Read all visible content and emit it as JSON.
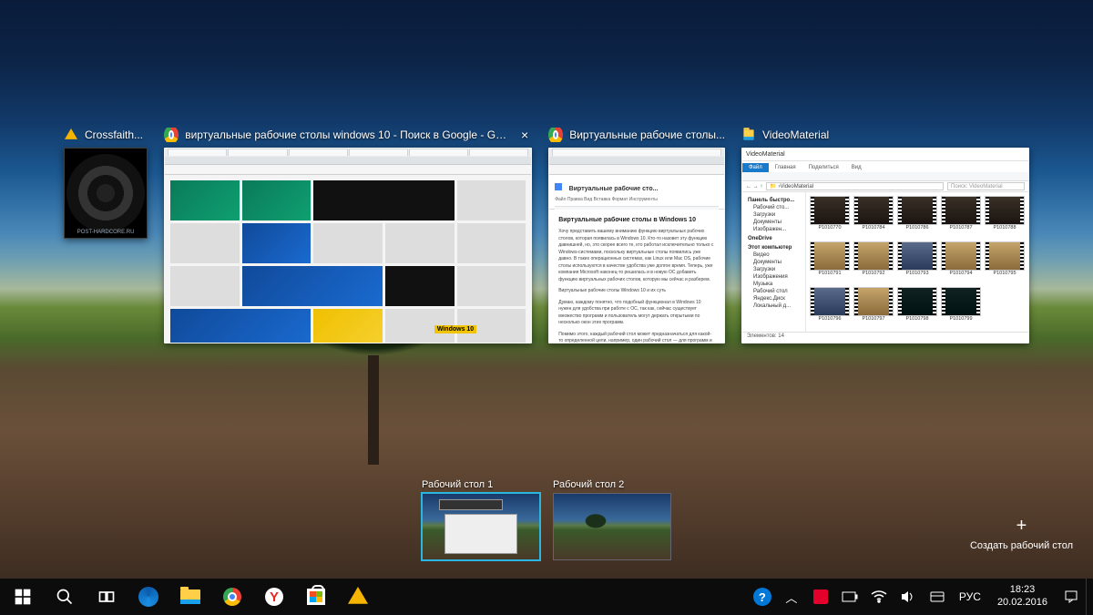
{
  "windows": [
    {
      "icon": "aimp-icon",
      "title": "Crossfaith...",
      "caption": "POST-HARDCORE.RU"
    },
    {
      "icon": "chrome-icon",
      "title": "виртуальные рабочие столы windows 10 - Поиск в Google - Google Ch...",
      "badge": "Windows 10"
    },
    {
      "icon": "chrome-icon",
      "title": "Виртуальные рабочие столы...",
      "doc_title": "Виртуальные рабочие сто...",
      "doc_menu": "Файл  Правка  Вид  Вставка  Формат  Инструменты",
      "doc_heading": "Виртуальные рабочие столы в Windows 10",
      "doc_para1": "Хочу представить вашему вниманию функцию виртуальных рабочих столов, которая появилась в Windows 10. Кто-то назовет эту функцию давнишней, но, это скорее всего те, кто работал исключительно только с Windows-системами, поскольку виртуальные столы появились уже давно. В таких операционных системах, как Linux или Mac OS, рабочие столы используются в качестве удобства уже долгое время. Теперь, уже компания Microsoft наконец-то решилась и в новую ОС добавить функцию виртуальных рабочих столов, которую мы сейчас и разберем.",
      "doc_para2": "Виртуальные рабочие столы Windows 10 и их суть",
      "doc_para3": "Думаю, каждому понятно, что подобный функционал в Windows 10 нужен для удобства при работе с ОС, так как, сейчас существует множество программ и пользователь могут держать открытыми по несколько окон этих программ.",
      "doc_para4": "Помимо этого, каждый рабочий стол может предназначаться для какой-то определенной цели, например, один рабочий стол — для программ и документов, другой"
    },
    {
      "icon": "folder-icon",
      "title": "VideoMaterial",
      "ribbon_tabs": [
        "Файл",
        "Главная",
        "Поделиться",
        "Вид"
      ],
      "path_label": "VideoMaterial",
      "search_placeholder": "Поиск: VideoMaterial",
      "nav_quick": "Панель быстро...",
      "nav_items_quick": [
        "Рабочий сто...",
        "Загрузки",
        "Документы",
        "Изображен..."
      ],
      "nav_onedrive": "OneDrive",
      "nav_thispc": "Этот компьютер",
      "nav_items_pc": [
        "Видео",
        "Документы",
        "Загрузки",
        "Изображения",
        "Музыка",
        "Рабочий стол",
        "Яндекс.Диск",
        "Локальный д..."
      ],
      "files": [
        "P1010770",
        "P1010784",
        "P1010786",
        "P1010787",
        "P1010788",
        "P1010791",
        "P1010792",
        "P1010793",
        "P1010794",
        "P1010795",
        "P1010796",
        "P1010797",
        "P1010798",
        "P1010799"
      ],
      "status": "Элементов: 14"
    }
  ],
  "desktops": [
    {
      "label": "Рабочий стол 1",
      "selected": true
    },
    {
      "label": "Рабочий стол 2",
      "selected": false
    }
  ],
  "new_desktop_label": "Создать рабочий стол",
  "tray": {
    "lang": "РУС",
    "time": "18:23",
    "date": "20.02.2016"
  }
}
